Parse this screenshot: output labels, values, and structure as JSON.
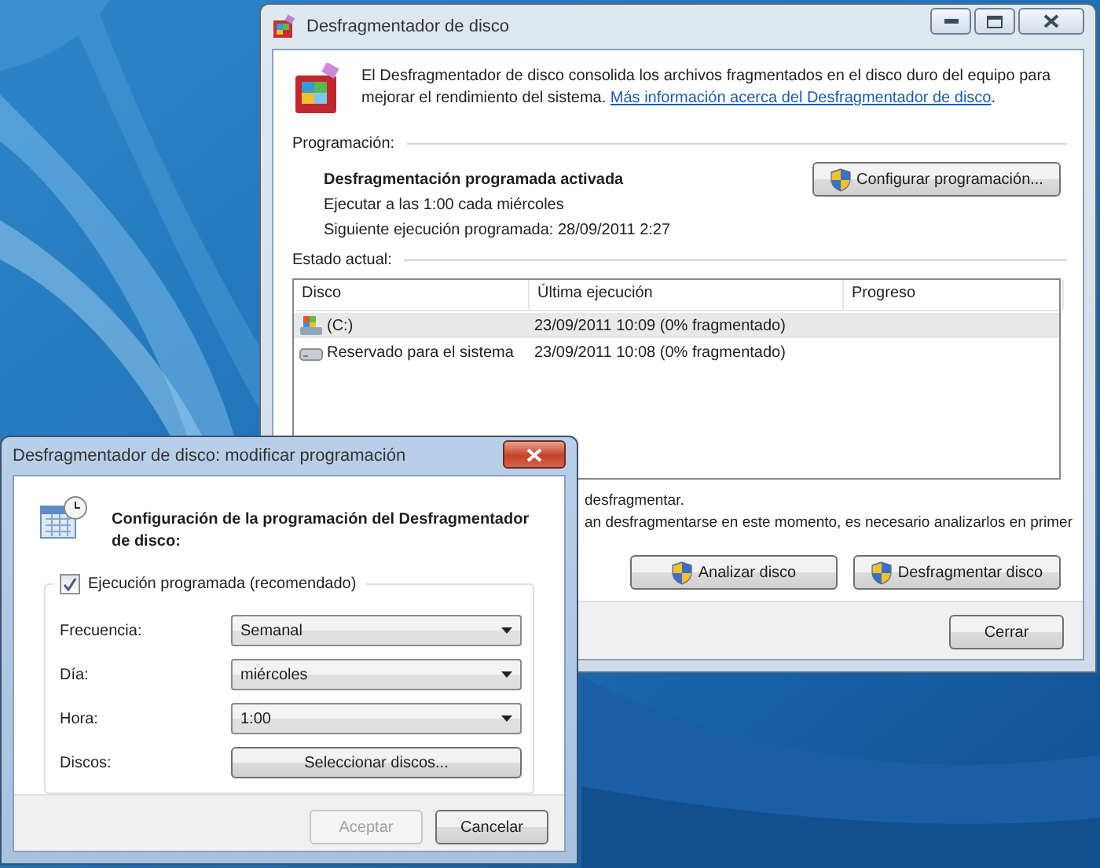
{
  "main_window": {
    "title": "Desfragmentador de disco",
    "description": "El Desfragmentador de disco consolida los archivos fragmentados en el disco duro del equipo para mejorar el rendimiento del sistema.",
    "link": "Más información acerca del Desfragmentador de disco",
    "description_end": ".",
    "schedule_heading": "Programación:",
    "schedule_status": "Desfragmentación programada activada",
    "schedule_run": "Ejecutar a las 1:00 cada miércoles",
    "next_run": "Siguiente ejecución programada: 28/09/2011 2:27",
    "configure_button": "Configurar programación...",
    "status_heading": "Estado actual:",
    "table": {
      "columns": [
        "Disco",
        "Última ejecución",
        "Progreso"
      ],
      "rows": [
        {
          "kind": "system",
          "disk": "(C:)",
          "last_run": "23/09/2011 10:09 (0% fragmentado)",
          "selected": true
        },
        {
          "kind": "drive",
          "disk": "Reservado para el sistema",
          "last_run": "23/09/2011 10:08 (0% fragmentado)",
          "selected": false
        }
      ]
    },
    "notes": [
      "desfragmentar.",
      "an desfragmentarse en este momento, es necesario analizarlos en primer"
    ],
    "buttons": [
      "Analizar disco",
      "Desfragmentar disco"
    ],
    "close_button": "Cerrar"
  },
  "dialog": {
    "title": "Desfragmentador de disco: modificar programación",
    "heading": "Configuración de la programación del Desfragmentador de disco:",
    "checkbox": {
      "label": "Ejecución programada (recomendado)",
      "checked": true
    },
    "fields": [
      {
        "kind": "combo",
        "label": "Frecuencia:",
        "value": "Semanal"
      },
      {
        "kind": "combo",
        "label": "Día:",
        "value": "miércoles"
      },
      {
        "kind": "combo",
        "label": "Hora:",
        "value": "1:00"
      },
      {
        "kind": "button",
        "label": "Discos:",
        "value": "Seleccionar discos..."
      }
    ],
    "buttons": [
      {
        "label": "Aceptar",
        "disabled": true
      },
      {
        "label": "Cancelar",
        "disabled": false
      }
    ]
  }
}
